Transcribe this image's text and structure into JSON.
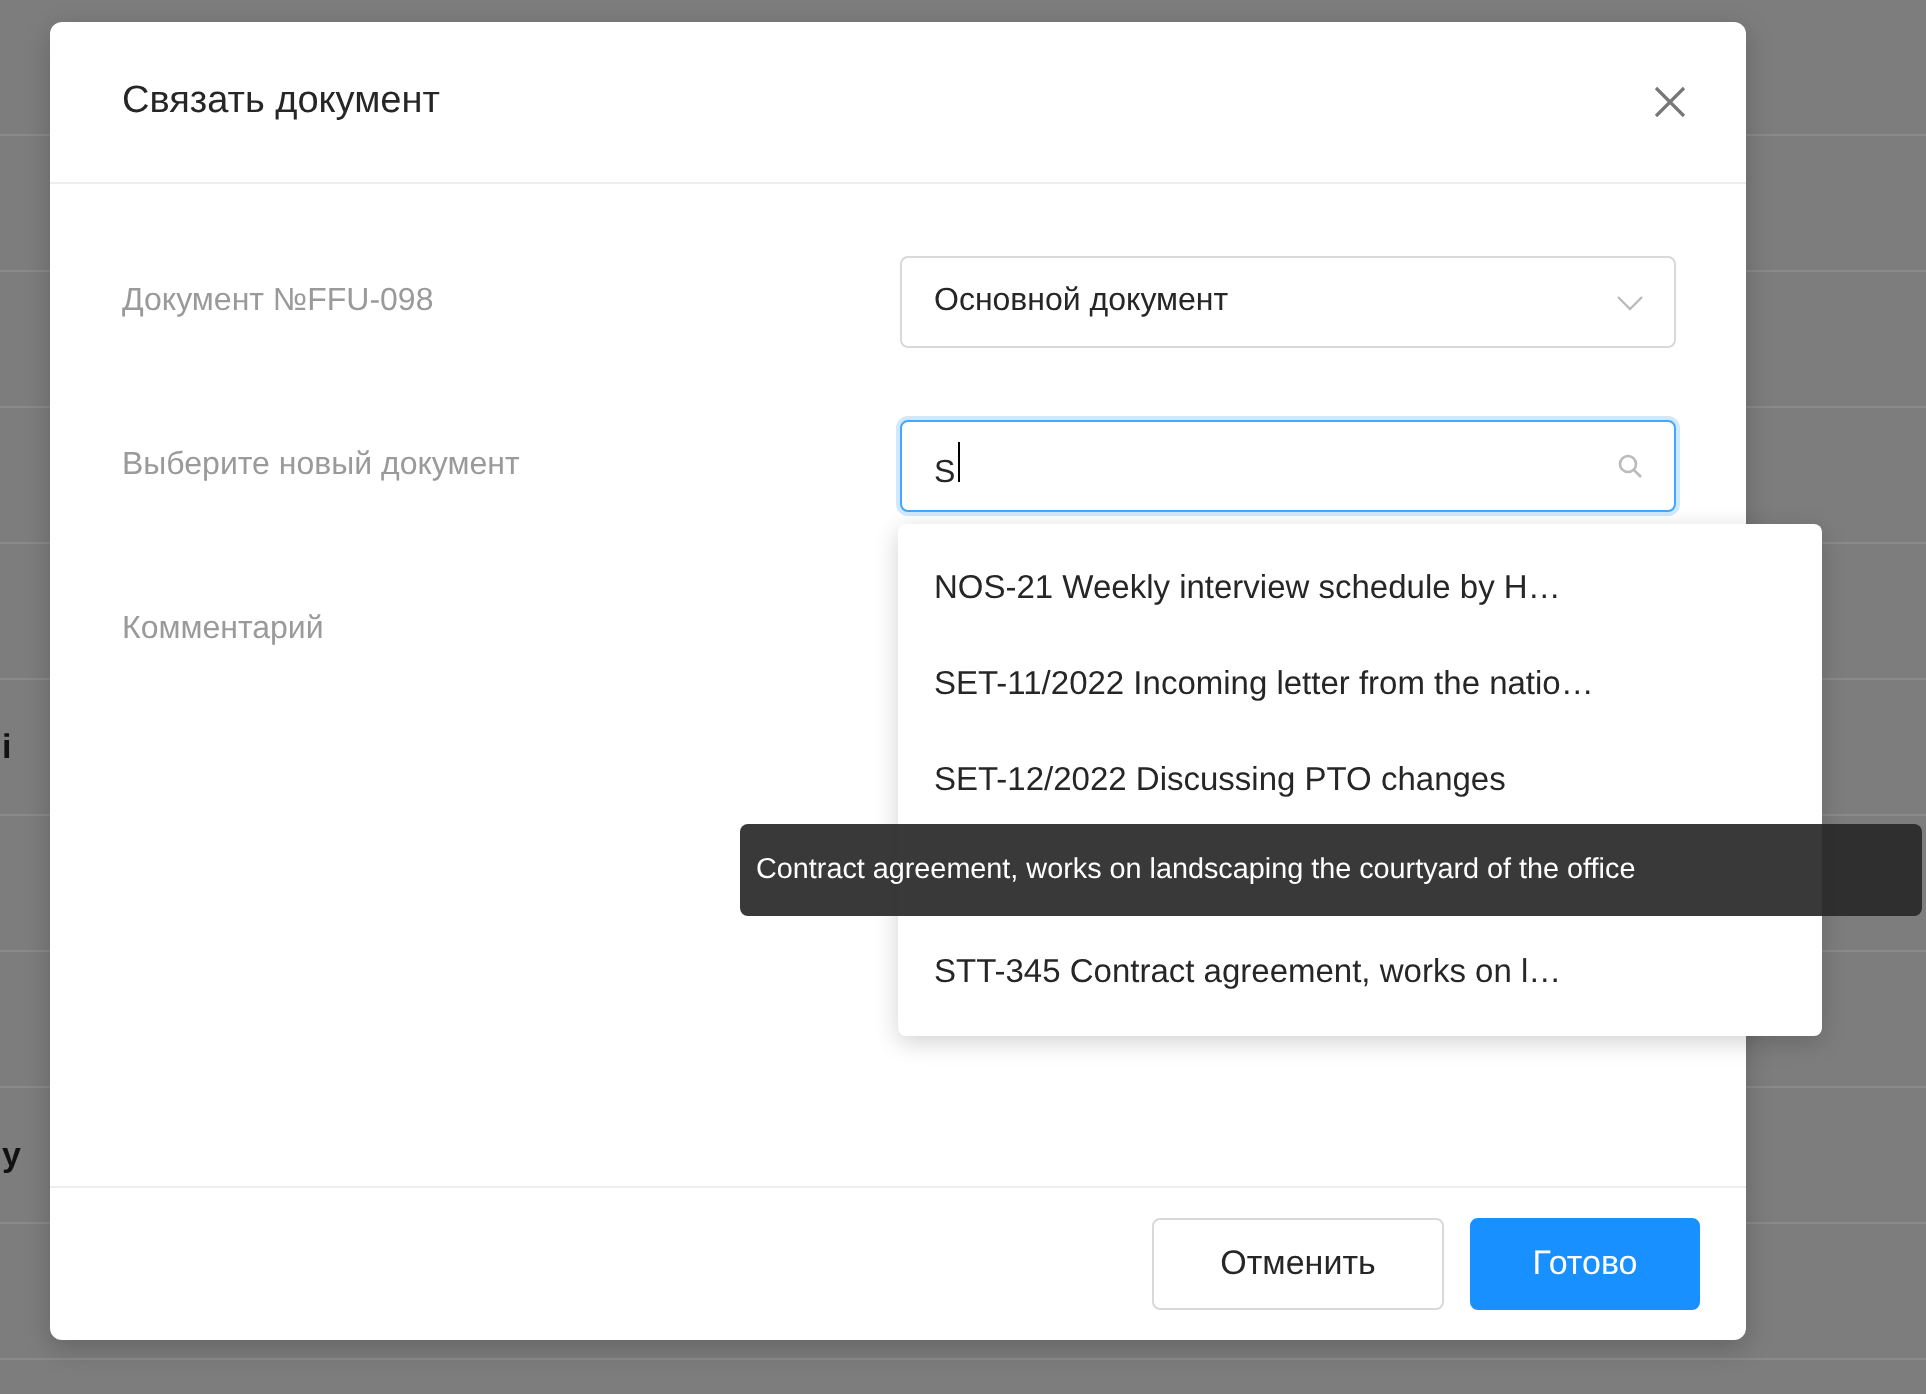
{
  "background": {
    "fragments": [
      "i",
      "y"
    ]
  },
  "dialog": {
    "title": "Связать документ",
    "fields": [
      {
        "kind": "select",
        "label": "Документ №FFU-098",
        "value": "Основной документ",
        "focused": false
      },
      {
        "kind": "search",
        "label": "Выберите новый документ",
        "value": "S",
        "focused": true
      },
      {
        "kind": "hidden",
        "label": "Комментарий"
      }
    ],
    "dropdown": {
      "options": [
        {
          "kind": "text",
          "label": "NOS-21 Weekly interview schedule by H…"
        },
        {
          "kind": "text",
          "label": "SET-11/2022 Incoming letter from the natio…"
        },
        {
          "kind": "text",
          "label": "SET-12/2022 Discussing PTO changes"
        },
        {
          "kind": "covered"
        },
        {
          "kind": "text",
          "label": "STT-345 Contract agreement, works on l…"
        }
      ]
    },
    "tooltip": "Contract agreement, works on landscaping the courtyard of the office",
    "buttons": [
      {
        "label": "Отменить",
        "kind": "secondary"
      },
      {
        "label": "Готово",
        "kind": "primary"
      }
    ]
  }
}
